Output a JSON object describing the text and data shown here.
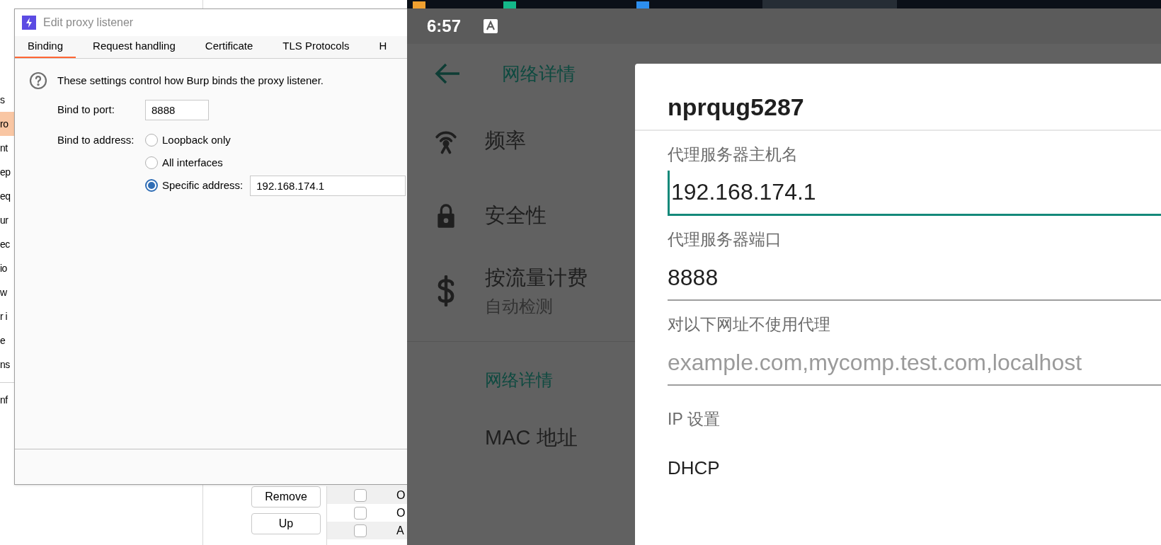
{
  "burp_background": {
    "sidebar_items": [
      {
        "label": "s",
        "selected": false
      },
      {
        "label": "ro",
        "selected": true
      },
      {
        "label": "nt",
        "selected": false
      },
      {
        "label": "ep",
        "selected": false
      },
      {
        "label": "eq",
        "selected": false
      },
      {
        "label": "ur",
        "selected": false
      },
      {
        "label": "ec",
        "selected": false
      },
      {
        "label": "io",
        "selected": false
      },
      {
        "label": "w",
        "selected": false
      },
      {
        "label": "r i",
        "selected": false
      },
      {
        "label": "e",
        "selected": false
      },
      {
        "label": "ns",
        "selected": false
      }
    ],
    "sidebar_footer": "nf",
    "buttons": [
      "Remove",
      "Up"
    ],
    "table_rows": [
      {
        "label": "O",
        "checked": false
      },
      {
        "label": "O",
        "checked": false
      },
      {
        "label": "A",
        "checked": false
      }
    ]
  },
  "dialog": {
    "title": "Edit proxy listener",
    "tabs": [
      {
        "label": "Binding",
        "selected": true
      },
      {
        "label": "Request handling",
        "selected": false
      },
      {
        "label": "Certificate",
        "selected": false
      },
      {
        "label": "TLS Protocols",
        "selected": false
      },
      {
        "label": "H",
        "selected": false
      }
    ],
    "help_text": "These settings control how Burp binds the proxy listener.",
    "port_label": "Bind to port:",
    "port_value": "8888",
    "address_label": "Bind to address:",
    "address_options": [
      {
        "label": "Loopback only",
        "selected": false
      },
      {
        "label": "All interfaces",
        "selected": false
      },
      {
        "label": "Specific address:",
        "selected": true
      }
    ],
    "specific_address": "192.168.174.1"
  },
  "phone": {
    "status_bar": {
      "time": "6:57"
    },
    "app_bar": {
      "title": "网络详情"
    },
    "items": [
      {
        "kind": "frequency",
        "label": "频率"
      },
      {
        "kind": "security",
        "label": "安全性"
      },
      {
        "kind": "metered",
        "label": "按流量计费",
        "sublabel": "自动检测"
      }
    ],
    "section_header": "网络详情",
    "section_items": [
      {
        "label": "MAC 地址"
      }
    ],
    "proxy_dialog": {
      "title": "nprqug5287",
      "fields": [
        {
          "label": "代理服务器主机名",
          "value": "192.168.174.1",
          "focused": true
        },
        {
          "label": "代理服务器端口",
          "value": "8888",
          "focused": false
        },
        {
          "label": "对以下网址不使用代理",
          "placeholder": "example.com,mycomp.test.com,localhost",
          "focused": false
        }
      ],
      "ip_settings": {
        "label": "IP 设置",
        "value": "DHCP"
      }
    }
  }
}
